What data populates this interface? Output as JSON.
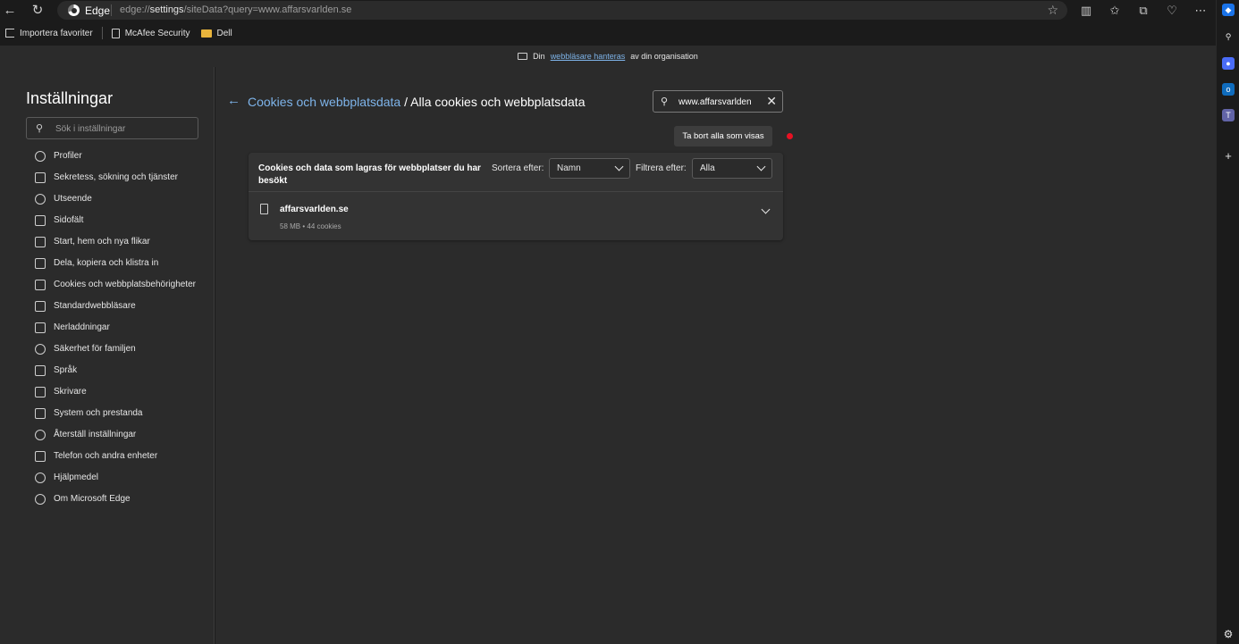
{
  "browser": {
    "brand_label": "Edge",
    "url_prefix": "edge://",
    "url_path": "settings",
    "url_rest": "/siteData?query=www.affarsvarlden.se"
  },
  "favorites": [
    {
      "label": "Importera favoriter",
      "icon": "import-icon"
    },
    {
      "label": "McAfee Security",
      "icon": "page-icon"
    },
    {
      "label": "Dell",
      "icon": "folder-icon"
    }
  ],
  "banner": {
    "prefix": "Din",
    "link": "webbläsare hanteras",
    "suffix": "av din organisation"
  },
  "settings": {
    "title": "Inställningar",
    "search_placeholder": "Sök i inställningar",
    "nav_items": [
      {
        "label": "Profiler",
        "icon": "profile-icon"
      },
      {
        "label": "Sekretess, sökning och tjänster",
        "icon": "lock-icon"
      },
      {
        "label": "Utseende",
        "icon": "palette-icon"
      },
      {
        "label": "Sidofält",
        "icon": "sidebar-icon"
      },
      {
        "label": "Start, hem och nya flikar",
        "icon": "home-icon"
      },
      {
        "label": "Dela, kopiera och klistra in",
        "icon": "share-icon"
      },
      {
        "label": "Cookies och webbplatsbehörigheter",
        "icon": "cookie-icon"
      },
      {
        "label": "Standardwebbläsare",
        "icon": "browser-icon"
      },
      {
        "label": "Nerladdningar",
        "icon": "download-icon"
      },
      {
        "label": "Säkerhet för familjen",
        "icon": "family-icon"
      },
      {
        "label": "Språk",
        "icon": "language-icon"
      },
      {
        "label": "Skrivare",
        "icon": "printer-icon"
      },
      {
        "label": "System och prestanda",
        "icon": "laptop-icon"
      },
      {
        "label": "Återställ inställningar",
        "icon": "reset-icon"
      },
      {
        "label": "Telefon och andra enheter",
        "icon": "phone-icon"
      },
      {
        "label": "Hjälpmedel",
        "icon": "accessibility-icon"
      },
      {
        "label": "Om Microsoft Edge",
        "icon": "edge-icon"
      }
    ]
  },
  "main": {
    "breadcrumb_link": "Cookies och webbplatsdata",
    "breadcrumb_current": " / Alla cookies och webbplatsdata",
    "search_value": "www.affarsvarlden",
    "remove_all_label": "Ta bort alla som visas",
    "card": {
      "description": "Cookies och data som lagras för webbplatser du har besökt",
      "sort_label": "Sortera efter:",
      "sort_value": "Namn",
      "filter_label": "Filtrera efter:",
      "filter_value": "Alla",
      "site": {
        "name": "affarsvarlden.se",
        "meta": "58 MB • 44 cookies"
      }
    }
  },
  "colors": {
    "accent_link": "#7eb4ea",
    "notification_dot": "#e81123",
    "folder": "#e8b43c"
  }
}
